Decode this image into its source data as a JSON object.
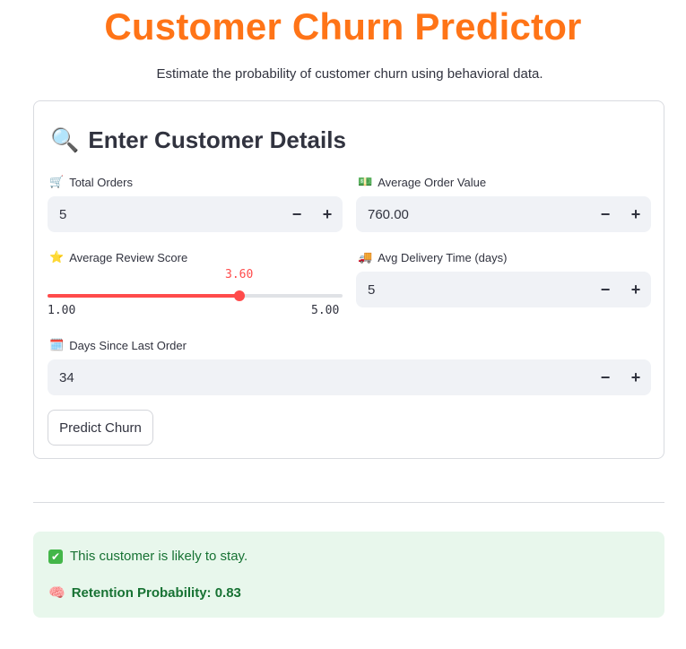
{
  "header": {
    "title": "Customer Churn Predictor",
    "subtitle": "Estimate the probability of customer churn using behavioral data."
  },
  "form": {
    "heading_icon": "🔍",
    "heading": "Enter Customer Details",
    "total_orders": {
      "icon": "🛒",
      "label": "Total Orders",
      "value": "5"
    },
    "avg_order_value": {
      "icon": "💵",
      "label": "Average Order Value",
      "value": "760.00"
    },
    "avg_review_score": {
      "icon": "⭐",
      "label": "Average Review Score",
      "value": "3.60",
      "min": "1.00",
      "max": "5.00",
      "fraction": 0.65
    },
    "avg_delivery_time": {
      "icon": "🚚",
      "label": "Avg Delivery Time (days)",
      "value": "5"
    },
    "days_since_last_order": {
      "icon": "🗓️",
      "label": "Days Since Last Order",
      "value": "34"
    },
    "stepper": {
      "minus": "−",
      "plus": "+"
    },
    "predict_button": "Predict Churn"
  },
  "result": {
    "status_icon": "✔",
    "status_text": "This customer is likely to stay.",
    "prob_icon": "🧠",
    "prob_text": "Retention Probability: 0.83",
    "colors": {
      "background": "#e8f7ec",
      "text": "#177233",
      "check": "#43b649"
    }
  },
  "colors": {
    "title": "#ff7417",
    "accent": "#ff4b4b",
    "input_bg": "#f0f2f6"
  }
}
